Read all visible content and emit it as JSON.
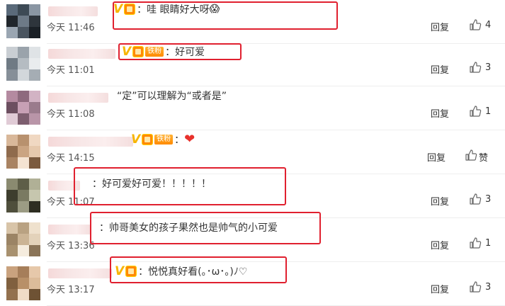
{
  "comments": [
    {
      "pre": "",
      "vip": true,
      "fan": "",
      "text": "：哇 眼睛好大呀",
      "emoji": "😱",
      "time": "今天 11:46",
      "reply": "回复",
      "likes": "4"
    },
    {
      "pre": "",
      "vip": true,
      "fan": "铁粉",
      "text": "：好可爱",
      "emoji": "",
      "time": "今天 11:01",
      "reply": "回复",
      "likes": "3"
    },
    {
      "pre": "",
      "vip": false,
      "fan": "",
      "text": "“定”可以理解为“或者是”",
      "emoji": "",
      "time": "今天 11:08",
      "reply": "回复",
      "likes": "1"
    },
    {
      "pre": "",
      "vip": true,
      "fan": "铁粉",
      "text": "：",
      "emoji": "❤",
      "time": "今天 14:15",
      "reply": "回复",
      "likes": "赞"
    },
    {
      "pre": "",
      "vip": false,
      "fan": "",
      "text": "：好可爱好可爱！！！！！",
      "emoji": "",
      "time": "今天 11:07",
      "reply": "回复",
      "likes": "3"
    },
    {
      "pre": "",
      "vip": false,
      "fan": "",
      "text": "：帅哥美女的孩子果然也是帅气的小可爱",
      "emoji": "",
      "time": "今天 13:36",
      "reply": "回复",
      "likes": "1"
    },
    {
      "pre": "",
      "vip": true,
      "fan": "",
      "text": "：悦悦真好看(｡･ω･｡)ﾉ♡",
      "emoji": "",
      "time": "今天 13:17",
      "reply": "回复",
      "likes": "3"
    }
  ],
  "icons": {
    "vip": "vip-v-icon",
    "crown": "crown-badge-icon",
    "thumb": "thumbs-up-icon"
  },
  "colors": {
    "highlight": "#e0202f",
    "vip": "#f7b500"
  }
}
